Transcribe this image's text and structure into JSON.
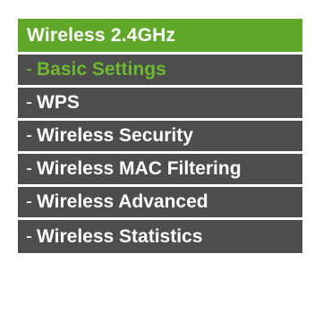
{
  "menu": {
    "header": "Wireless 2.4GHz",
    "prefix": "-",
    "items": [
      {
        "label": "Basic Settings",
        "active": true
      },
      {
        "label": "WPS",
        "active": false
      },
      {
        "label": "Wireless Security",
        "active": false
      },
      {
        "label": "Wireless MAC Filtering",
        "active": false
      },
      {
        "label": "Wireless Advanced",
        "active": false
      },
      {
        "label": "Wireless Statistics",
        "active": false
      }
    ]
  },
  "colors": {
    "header_bg": "#60a82a",
    "item_bg": "#4d4d4d",
    "active_text": "#6dba2e",
    "text": "#ffffff"
  }
}
